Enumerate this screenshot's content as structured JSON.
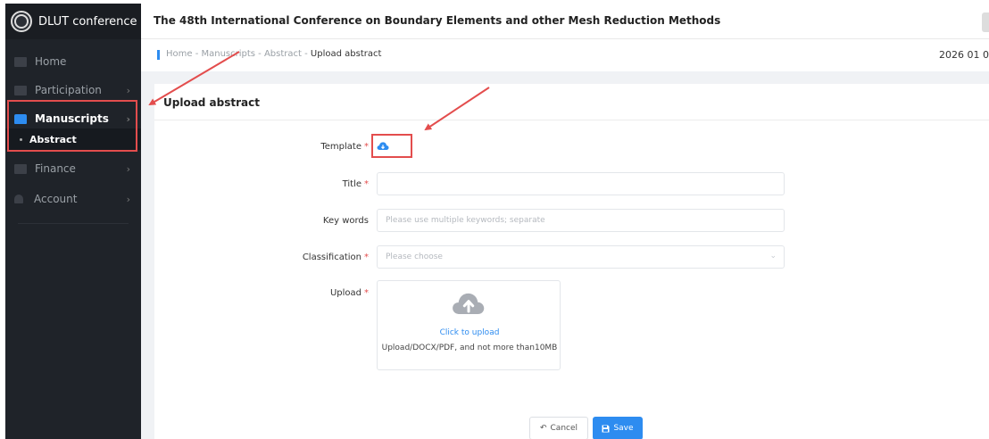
{
  "app": {
    "brand": "DLUT conference",
    "header_title": "The 48th International Conference on Boundary Elements and other Mesh Reduction Methods",
    "date": "2026 01 0"
  },
  "sidebar": {
    "items": [
      {
        "label": "Home"
      },
      {
        "label": "Participation",
        "chevron": "›"
      },
      {
        "label": "Manuscripts",
        "chevron": "›"
      },
      {
        "label": "Abstract"
      },
      {
        "label": "Finance",
        "chevron": "›"
      },
      {
        "label": "Account",
        "chevron": "›"
      }
    ],
    "collapse_glyph": "»"
  },
  "breadcrumb": {
    "path": "Home - Manuscripts - Abstract - ",
    "current": "Upload abstract"
  },
  "form": {
    "card_title": "Upload abstract",
    "required_mark": "*",
    "template_label": "Template",
    "title_label": "Title",
    "title_value": "",
    "keywords_label": "Key words",
    "keywords_placeholder": "Please use multiple keywords; separate",
    "classification_label": "Classification",
    "classification_placeholder": "Please choose",
    "chevron_down": "⌄",
    "upload_label": "Upload",
    "upload_link": "Click to upload",
    "upload_hint": "Upload/DOCX/PDF,   and not more than10MB",
    "cancel_label": "Cancel",
    "save_label": "Save"
  },
  "colors": {
    "accent": "#2d8cf0",
    "annotation": "#e34d4d",
    "sidebar_bg": "#1f2329"
  },
  "icons": {
    "template": "cloud-download-icon",
    "upload": "cloud-upload-icon",
    "cancel": "undo-icon",
    "save": "floppy-disk-icon"
  }
}
